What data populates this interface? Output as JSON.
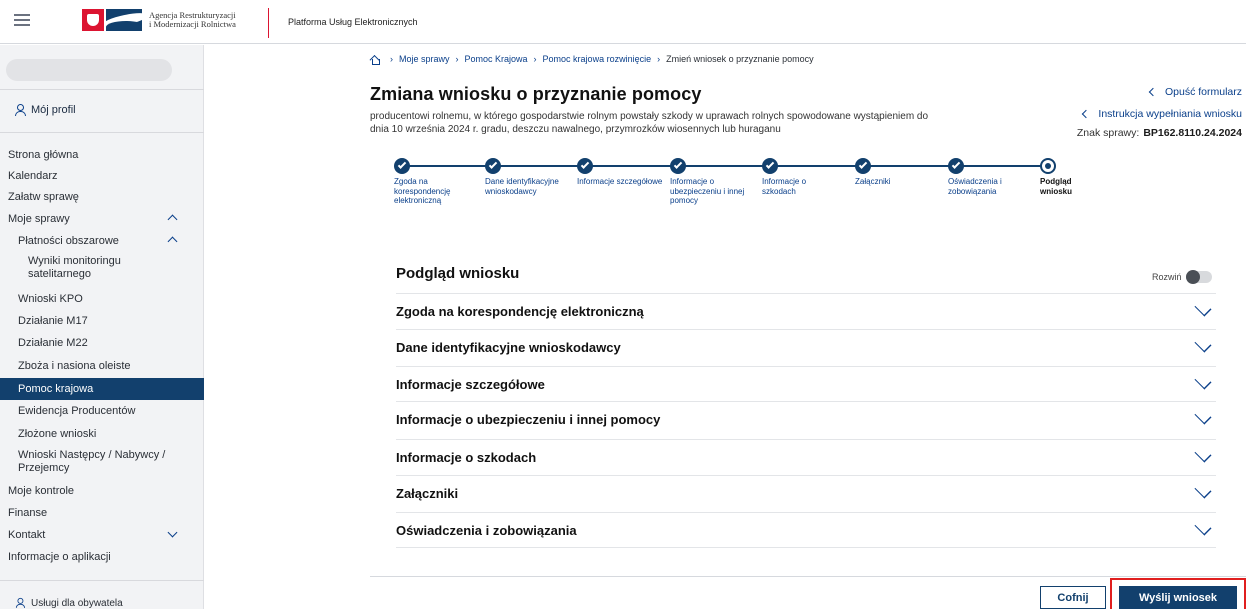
{
  "header": {
    "org_name_line1": "Agencja Restrukturyzacji",
    "org_name_line2": "i Modernizacji Rolnictwa",
    "platform": "Platforma Usług Elektronicznych",
    "logo_icon": "arimr-logo",
    "menu_icon": "hamburger-icon"
  },
  "sidebar": {
    "profile": "Mój profil",
    "items": [
      {
        "label": "Strona główna"
      },
      {
        "label": "Kalendarz"
      },
      {
        "label": "Załatw sprawę"
      },
      {
        "label": "Moje sprawy",
        "expanded": true
      },
      {
        "label": "Płatności obszarowe",
        "expanded": true
      },
      {
        "label": "Wyniki monitoringu satelitarnego"
      },
      {
        "label": "Wnioski KPO"
      },
      {
        "label": "Działanie M17"
      },
      {
        "label": "Działanie M22"
      },
      {
        "label": "Zboża i nasiona oleiste"
      },
      {
        "label": "Pomoc krajowa",
        "active": true
      },
      {
        "label": "Ewidencja Producentów"
      },
      {
        "label": "Złożone wnioski"
      },
      {
        "label": "Wnioski Następcy / Nabywcy / Przejemcy"
      },
      {
        "label": "Moje kontrole"
      },
      {
        "label": "Finanse"
      },
      {
        "label": "Kontakt",
        "expanded": false
      },
      {
        "label": "Informacje o aplikacji"
      }
    ],
    "services": "Usługi dla obywatela"
  },
  "breadcrumb": [
    "Moje sprawy",
    "Pomoc Krajowa",
    "Pomoc krajowa rozwinięcie",
    "Zmień wniosek o przyznanie pomocy"
  ],
  "page": {
    "title": "Zmiana wniosku o przyznanie pomocy",
    "subtitle": "producentowi rolnemu, w którego gospodarstwie rolnym powstały szkody w uprawach rolnych spowodowane wystąpieniem do dnia 10 września 2024 r. gradu, deszczu nawalnego, przymrozków wiosennych lub huraganu",
    "leave_form": "Opuść formularz",
    "instructions": "Instrukcja wypełniania wniosku",
    "case_label": "Znak sprawy:",
    "case_number": "BP162.8110.24.2024"
  },
  "steps": [
    {
      "label": "Zgoda na korespondencję elektroniczną",
      "status": "done"
    },
    {
      "label": "Dane identyfikacyjne wnioskodawcy",
      "status": "done"
    },
    {
      "label": "Informacje szczegółowe",
      "status": "done"
    },
    {
      "label": "Informacje o ubezpieczeniu i innej pomocy",
      "status": "done"
    },
    {
      "label": "Informacje o szkodach",
      "status": "done"
    },
    {
      "label": "Załączniki",
      "status": "done"
    },
    {
      "label": "Oświadczenia i zobowiązania",
      "status": "done"
    },
    {
      "label": "Podgląd wniosku",
      "status": "current"
    }
  ],
  "preview": {
    "title": "Podgląd wniosku",
    "expand_label": "Rozwiń",
    "expand_on": false,
    "sections": [
      "Zgoda na korespondencję elektroniczną",
      "Dane identyfikacyjne wnioskodawcy",
      "Informacje szczegółowe",
      "Informacje o ubezpieczeniu i innej pomocy",
      "Informacje o szkodach",
      "Załączniki",
      "Oświadczenia i zobowiązania"
    ]
  },
  "actions": {
    "back": "Cofnij",
    "submit": "Wyślij wniosek"
  },
  "colors": {
    "primary": "#12406d",
    "link": "#0a3f8a",
    "highlight": "#e01f1f",
    "brand_red": "#dc1431"
  }
}
